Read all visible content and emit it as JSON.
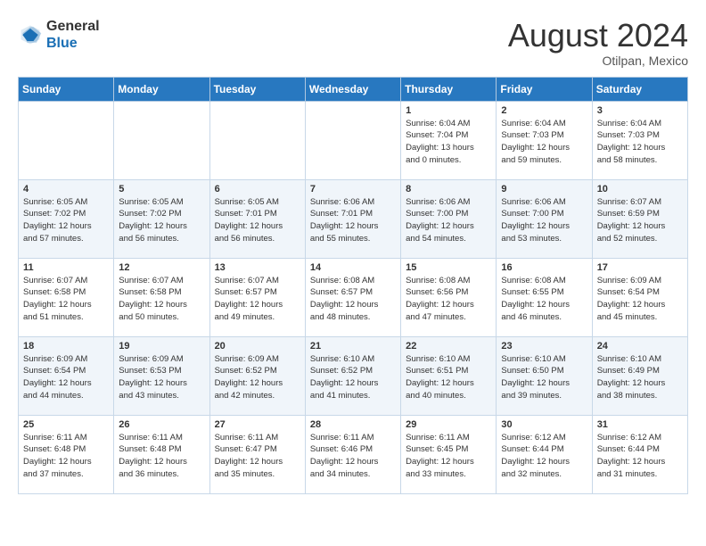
{
  "header": {
    "logo_line1": "General",
    "logo_line2": "Blue",
    "month_year": "August 2024",
    "location": "Otilpan, Mexico"
  },
  "weekdays": [
    "Sunday",
    "Monday",
    "Tuesday",
    "Wednesday",
    "Thursday",
    "Friday",
    "Saturday"
  ],
  "weeks": [
    [
      {
        "day": "",
        "info": ""
      },
      {
        "day": "",
        "info": ""
      },
      {
        "day": "",
        "info": ""
      },
      {
        "day": "",
        "info": ""
      },
      {
        "day": "1",
        "info": "Sunrise: 6:04 AM\nSunset: 7:04 PM\nDaylight: 13 hours\nand 0 minutes."
      },
      {
        "day": "2",
        "info": "Sunrise: 6:04 AM\nSunset: 7:03 PM\nDaylight: 12 hours\nand 59 minutes."
      },
      {
        "day": "3",
        "info": "Sunrise: 6:04 AM\nSunset: 7:03 PM\nDaylight: 12 hours\nand 58 minutes."
      }
    ],
    [
      {
        "day": "4",
        "info": "Sunrise: 6:05 AM\nSunset: 7:02 PM\nDaylight: 12 hours\nand 57 minutes."
      },
      {
        "day": "5",
        "info": "Sunrise: 6:05 AM\nSunset: 7:02 PM\nDaylight: 12 hours\nand 56 minutes."
      },
      {
        "day": "6",
        "info": "Sunrise: 6:05 AM\nSunset: 7:01 PM\nDaylight: 12 hours\nand 56 minutes."
      },
      {
        "day": "7",
        "info": "Sunrise: 6:06 AM\nSunset: 7:01 PM\nDaylight: 12 hours\nand 55 minutes."
      },
      {
        "day": "8",
        "info": "Sunrise: 6:06 AM\nSunset: 7:00 PM\nDaylight: 12 hours\nand 54 minutes."
      },
      {
        "day": "9",
        "info": "Sunrise: 6:06 AM\nSunset: 7:00 PM\nDaylight: 12 hours\nand 53 minutes."
      },
      {
        "day": "10",
        "info": "Sunrise: 6:07 AM\nSunset: 6:59 PM\nDaylight: 12 hours\nand 52 minutes."
      }
    ],
    [
      {
        "day": "11",
        "info": "Sunrise: 6:07 AM\nSunset: 6:58 PM\nDaylight: 12 hours\nand 51 minutes."
      },
      {
        "day": "12",
        "info": "Sunrise: 6:07 AM\nSunset: 6:58 PM\nDaylight: 12 hours\nand 50 minutes."
      },
      {
        "day": "13",
        "info": "Sunrise: 6:07 AM\nSunset: 6:57 PM\nDaylight: 12 hours\nand 49 minutes."
      },
      {
        "day": "14",
        "info": "Sunrise: 6:08 AM\nSunset: 6:57 PM\nDaylight: 12 hours\nand 48 minutes."
      },
      {
        "day": "15",
        "info": "Sunrise: 6:08 AM\nSunset: 6:56 PM\nDaylight: 12 hours\nand 47 minutes."
      },
      {
        "day": "16",
        "info": "Sunrise: 6:08 AM\nSunset: 6:55 PM\nDaylight: 12 hours\nand 46 minutes."
      },
      {
        "day": "17",
        "info": "Sunrise: 6:09 AM\nSunset: 6:54 PM\nDaylight: 12 hours\nand 45 minutes."
      }
    ],
    [
      {
        "day": "18",
        "info": "Sunrise: 6:09 AM\nSunset: 6:54 PM\nDaylight: 12 hours\nand 44 minutes."
      },
      {
        "day": "19",
        "info": "Sunrise: 6:09 AM\nSunset: 6:53 PM\nDaylight: 12 hours\nand 43 minutes."
      },
      {
        "day": "20",
        "info": "Sunrise: 6:09 AM\nSunset: 6:52 PM\nDaylight: 12 hours\nand 42 minutes."
      },
      {
        "day": "21",
        "info": "Sunrise: 6:10 AM\nSunset: 6:52 PM\nDaylight: 12 hours\nand 41 minutes."
      },
      {
        "day": "22",
        "info": "Sunrise: 6:10 AM\nSunset: 6:51 PM\nDaylight: 12 hours\nand 40 minutes."
      },
      {
        "day": "23",
        "info": "Sunrise: 6:10 AM\nSunset: 6:50 PM\nDaylight: 12 hours\nand 39 minutes."
      },
      {
        "day": "24",
        "info": "Sunrise: 6:10 AM\nSunset: 6:49 PM\nDaylight: 12 hours\nand 38 minutes."
      }
    ],
    [
      {
        "day": "25",
        "info": "Sunrise: 6:11 AM\nSunset: 6:48 PM\nDaylight: 12 hours\nand 37 minutes."
      },
      {
        "day": "26",
        "info": "Sunrise: 6:11 AM\nSunset: 6:48 PM\nDaylight: 12 hours\nand 36 minutes."
      },
      {
        "day": "27",
        "info": "Sunrise: 6:11 AM\nSunset: 6:47 PM\nDaylight: 12 hours\nand 35 minutes."
      },
      {
        "day": "28",
        "info": "Sunrise: 6:11 AM\nSunset: 6:46 PM\nDaylight: 12 hours\nand 34 minutes."
      },
      {
        "day": "29",
        "info": "Sunrise: 6:11 AM\nSunset: 6:45 PM\nDaylight: 12 hours\nand 33 minutes."
      },
      {
        "day": "30",
        "info": "Sunrise: 6:12 AM\nSunset: 6:44 PM\nDaylight: 12 hours\nand 32 minutes."
      },
      {
        "day": "31",
        "info": "Sunrise: 6:12 AM\nSunset: 6:44 PM\nDaylight: 12 hours\nand 31 minutes."
      }
    ]
  ]
}
